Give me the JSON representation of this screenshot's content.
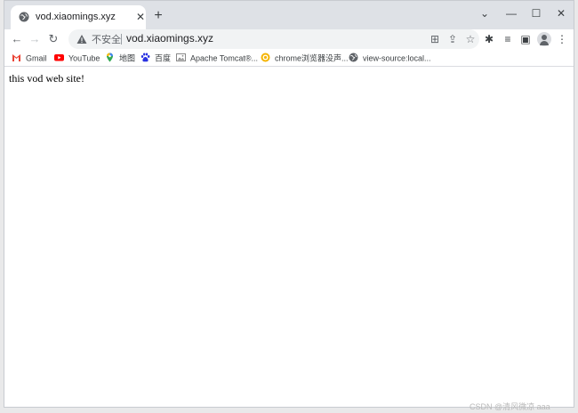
{
  "tab": {
    "title": "vod.xiaomings.xyz",
    "close": "✕",
    "new_tab": "+"
  },
  "window_controls": {
    "dropdown": "⌄",
    "minimize": "—",
    "maximize": "☐",
    "close": "✕"
  },
  "toolbar": {
    "back": "←",
    "forward": "→",
    "reload": "↻",
    "security_label": "不安全",
    "url": "vod.xiaomings.xyz",
    "translate": "⊞",
    "share": "⇪",
    "star": "☆",
    "extensions": "✱",
    "reading_list": "≡",
    "side_panel": "▣",
    "menu": "⋮"
  },
  "bookmarks": [
    {
      "label": "Gmail",
      "icon": "gmail-icon",
      "color": "#ea4335"
    },
    {
      "label": "YouTube",
      "icon": "youtube-icon",
      "color": "#ff0000"
    },
    {
      "label": "地图",
      "icon": "maps-icon",
      "color": "#34a853"
    },
    {
      "label": "百度",
      "icon": "baidu-icon",
      "color": "#2932e1"
    },
    {
      "label": "Apache Tomcat®...",
      "icon": "image-icon",
      "color": "#8a8a8a"
    },
    {
      "label": "chrome浏览器没声...",
      "icon": "csdn-icon",
      "color": "#f5b400"
    },
    {
      "label": "view-source:local...",
      "icon": "globe-icon",
      "color": "#5f6368"
    }
  ],
  "page": {
    "text": "this vod web site!"
  },
  "watermark": "CSDN @清风微凉 aaa"
}
